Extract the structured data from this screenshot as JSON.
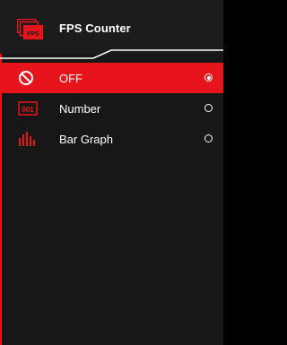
{
  "header": {
    "title": "FPS Counter",
    "icon": "fps-icon",
    "icon_text": "FPS"
  },
  "options": [
    {
      "label": "OFF",
      "icon": "prohibited-icon",
      "selected": true
    },
    {
      "label": "Number",
      "icon": "number-icon",
      "icon_text": "001",
      "selected": false
    },
    {
      "label": "Bar Graph",
      "icon": "bar-graph-icon",
      "selected": false
    }
  ],
  "colors": {
    "accent": "#e8141b",
    "background": "#171717",
    "text": "#ffffff"
  }
}
